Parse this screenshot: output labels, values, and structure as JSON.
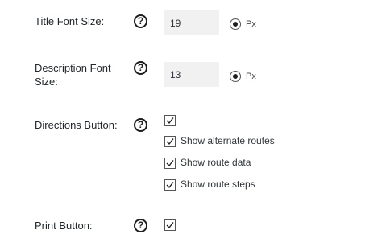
{
  "title_font_size": {
    "label": "Title Font Size:",
    "help": "?",
    "value": "19",
    "unit": "Px"
  },
  "description_font_size": {
    "label": "Description Font Size:",
    "help": "?",
    "value": "13",
    "unit": "Px"
  },
  "directions_button": {
    "label": "Directions Button:",
    "help": "?",
    "checked": true,
    "options": [
      {
        "label": "Show alternate routes",
        "checked": true
      },
      {
        "label": "Show route data",
        "checked": true
      },
      {
        "label": "Show route steps",
        "checked": true
      }
    ]
  },
  "print_button": {
    "label": "Print Button:",
    "help": "?",
    "checked": true
  },
  "icons": {
    "help": "question-circle-icon",
    "check": "checkmark-icon"
  }
}
